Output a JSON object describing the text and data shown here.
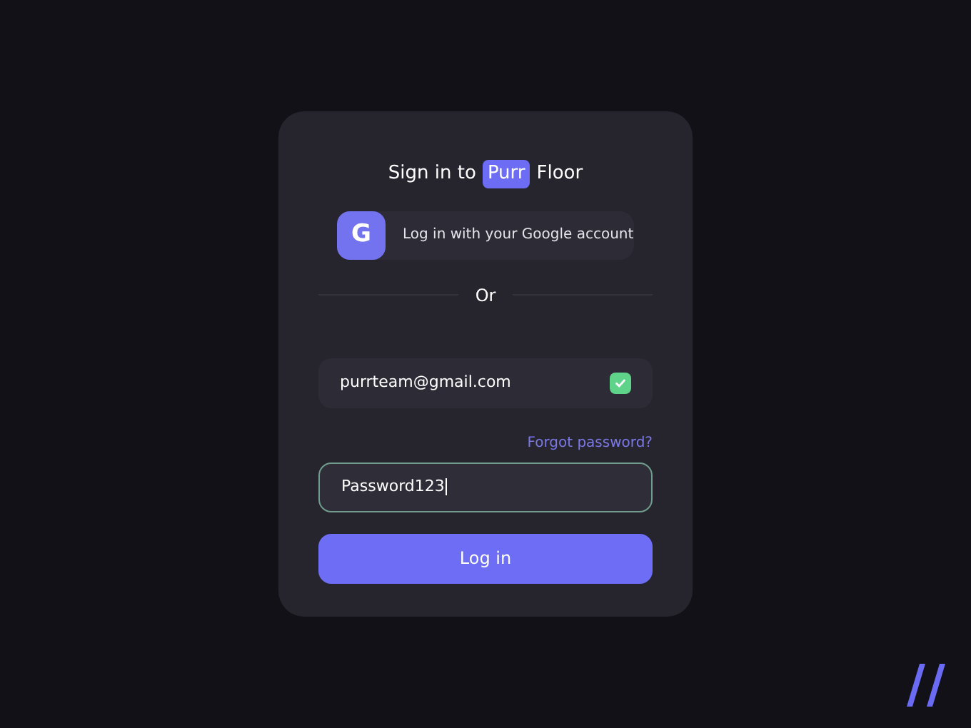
{
  "title": {
    "prefix": "Sign in to",
    "brand_highlight": "Purr",
    "brand_rest": "Floor"
  },
  "google_button": {
    "icon_letter": "G",
    "label": "Log in with your Google account"
  },
  "divider": "Or",
  "email_field": {
    "value": "purrteam@gmail.com",
    "valid": true
  },
  "forgot_link": "Forgot password?",
  "password_field": {
    "value": "Password123",
    "focused": true
  },
  "login_button": "Log in"
}
